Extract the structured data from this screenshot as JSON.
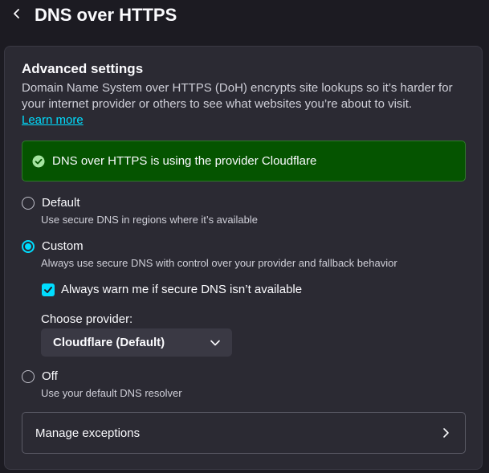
{
  "header": {
    "title": "DNS over HTTPS",
    "back_icon": "chevron-left-icon"
  },
  "settings": {
    "title": "Advanced settings",
    "description": "Domain Name System over HTTPS (DoH) encrypts site lookups so it’s harder for your internet provider or others to see what websites you’re about to visit.",
    "learn_more": "Learn more",
    "status": {
      "icon": "check-circle-icon",
      "text": "DNS over HTTPS is using the provider Cloudflare"
    },
    "options": [
      {
        "label": "Default",
        "description": "Use secure DNS in regions where it’s available",
        "selected": false
      },
      {
        "label": "Custom",
        "description": "Always use secure DNS with control over your provider and fallback behavior",
        "selected": true
      },
      {
        "label": "Off",
        "description": "Use your default DNS resolver",
        "selected": false
      }
    ],
    "warn_checkbox": {
      "label": "Always warn me if secure DNS isn’t available",
      "checked": true
    },
    "provider": {
      "label": "Choose provider:",
      "selected": "Cloudflare (Default)"
    },
    "manage_exceptions": "Manage exceptions"
  },
  "colors": {
    "background": "#1c1b22",
    "card": "#2b2a33",
    "accent": "#00ddff",
    "status_bg": "#055400",
    "text": "#fbfbfe"
  }
}
